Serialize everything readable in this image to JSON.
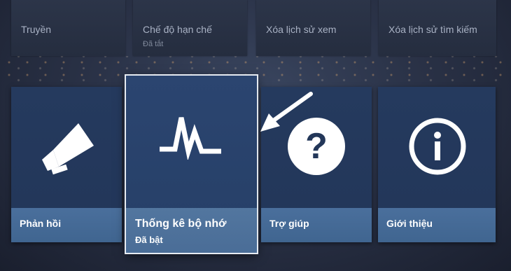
{
  "top_row": [
    {
      "title": "Truyền",
      "subtitle": ""
    },
    {
      "title": "Chế độ hạn chế",
      "subtitle": "Đã tắt"
    },
    {
      "title": "Xóa lịch sử xem",
      "subtitle": ""
    },
    {
      "title": "Xóa lịch sử tìm kiếm",
      "subtitle": ""
    }
  ],
  "tiles": [
    {
      "label": "Phản hồi",
      "icon": "megaphone-icon"
    },
    {
      "label": "Thống kê bộ nhớ",
      "sublabel": "Đã bật",
      "icon": "pulse-icon"
    },
    {
      "label": "Trợ giúp",
      "icon": "help-icon"
    },
    {
      "label": "Giới thiệu",
      "icon": "info-icon"
    }
  ],
  "colors": {
    "tile_bg": "#223659",
    "label_bar": "#406590",
    "focus_outline": "#e6ebf2"
  }
}
